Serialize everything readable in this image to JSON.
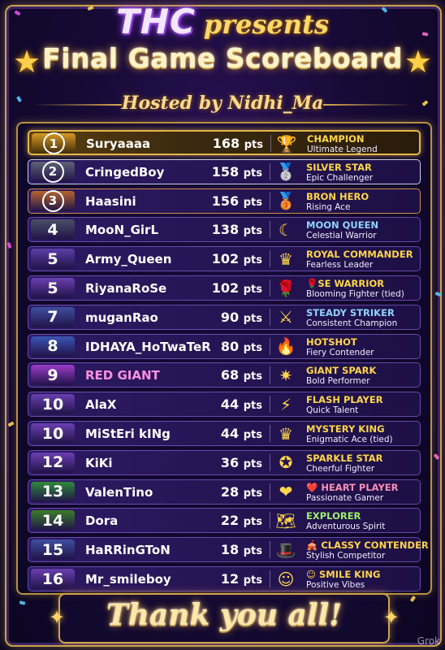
{
  "header": {
    "brand": "THC",
    "presents": "presents",
    "title": "Final Game Scoreboard",
    "hosted_by": "Hosted by Nidhi_Ma"
  },
  "colors": {
    "gold": "#ffd54a",
    "purple_row": "#2d1a63",
    "background": "#170a35"
  },
  "scoreboard": {
    "points_unit": "pts",
    "rows": [
      {
        "rank": "1",
        "name": "Suryaaaa",
        "points": "168",
        "icon": "trophy-icon",
        "glyph": "🏆",
        "award": "CHAMPION",
        "subtitle": "Ultimate Legend",
        "name_color": "#ffffff",
        "award_color": "#ffd54a",
        "rank_bg": "#d79a25"
      },
      {
        "rank": "2",
        "name": "CringedBoy",
        "points": "158",
        "icon": "silver-medal-icon",
        "glyph": "🥈",
        "award": "SILVER STAR",
        "subtitle": "Epic Challenger",
        "name_color": "#ffffff",
        "award_color": "#ffd54a",
        "rank_bg": "#5d6275"
      },
      {
        "rank": "3",
        "name": "Haasini",
        "points": "156",
        "icon": "bronze-medal-icon",
        "glyph": "🥉",
        "award": "BRON HERO",
        "subtitle": "Rising Ace",
        "name_color": "#ffffff",
        "award_color": "#ffd54a",
        "rank_bg": "#b5652b"
      },
      {
        "rank": "4",
        "name": "MooN_GirL",
        "points": "138",
        "icon": "crescent-moon-icon",
        "glyph": "☾",
        "award": "MOON QUEEN",
        "subtitle": "Celestial Warrior",
        "name_color": "#ffffff",
        "award_color": "#8fd2ff",
        "rank_bg": "#4a4f66"
      },
      {
        "rank": "5",
        "name": "Army_Queen",
        "points": "102",
        "icon": "crown-icon",
        "glyph": "♛",
        "award": "ROYAL COMMANDER",
        "subtitle": "Fearless Leader",
        "name_color": "#ffffff",
        "award_color": "#ffd54a",
        "rank_bg": "#5b3ea8"
      },
      {
        "rank": "5",
        "name": "RiyanaRoSe",
        "points": "102",
        "icon": "rose-icon",
        "glyph": "🌹",
        "award": "🌹SE WARRIOR",
        "subtitle": "Blooming Fighter (tied)",
        "name_color": "#ffffff",
        "award_color": "#ffd54a",
        "rank_bg": "#6a3fb0"
      },
      {
        "rank": "7",
        "name": "muganRao",
        "points": "90",
        "icon": "crossed-swords-icon",
        "glyph": "⚔",
        "award": "STEADY STRIKER",
        "subtitle": "Consistent Champion",
        "name_color": "#ffffff",
        "award_color": "#8fd2ff",
        "rank_bg": "#3e4fa0"
      },
      {
        "rank": "8",
        "name": "IDHAYA_HoTwaTeR",
        "points": "80",
        "icon": "flame-icon",
        "glyph": "🔥",
        "award": "HOTSHOT",
        "subtitle": "Fiery Contender",
        "name_color": "#ffffff",
        "award_color": "#ffd54a",
        "rank_bg": "#3a55b5"
      },
      {
        "rank": "9",
        "name": "RED GIANT",
        "points": "68",
        "icon": "burst-star-icon",
        "glyph": "✷",
        "award": "GIANT SPARK",
        "subtitle": "Bold Performer",
        "name_color": "#ff8fe0",
        "award_color": "#ffd54a",
        "rank_bg": "#9b3cc9"
      },
      {
        "rank": "10",
        "name": "AlaX",
        "points": "44",
        "icon": "lightning-icon",
        "glyph": "⚡",
        "award": "FLASH PLAYER",
        "subtitle": "Quick Talent",
        "name_color": "#ffffff",
        "award_color": "#ffd54a",
        "rank_bg": "#6a3fb0"
      },
      {
        "rank": "10",
        "name": "MiStEri kINg",
        "points": "44",
        "icon": "crown-icon",
        "glyph": "♛",
        "award": "MYSTERY KING",
        "subtitle": "Enigmatic Ace (tied)",
        "name_color": "#ffffff",
        "award_color": "#ffd54a",
        "rank_bg": "#6a3fb0"
      },
      {
        "rank": "12",
        "name": "KiKi",
        "points": "36",
        "icon": "star-badge-icon",
        "glyph": "✪",
        "award": "SPARKLE STAR",
        "subtitle": "Cheerful Fighter",
        "name_color": "#ffffff",
        "award_color": "#ffd54a",
        "rank_bg": "#6a3fb0"
      },
      {
        "rank": "13",
        "name": "ValenTino",
        "points": "28",
        "icon": "heart-icon",
        "glyph": "❤",
        "award": "❤️ HEART PLAYER",
        "subtitle": "Passionate Gamer",
        "name_color": "#ffffff",
        "award_color": "#ff8fb8",
        "rank_bg": "#2f8a3a"
      },
      {
        "rank": "14",
        "name": "Dora",
        "points": "22",
        "icon": "map-icon",
        "glyph": "🗺",
        "award": "EXPLORER",
        "subtitle": "Adventurous Spirit",
        "name_color": "#ffffff",
        "award_color": "#9ff06a",
        "rank_bg": "#3c7d2a"
      },
      {
        "rank": "15",
        "name": "HaRRinGToN",
        "points": "18",
        "icon": "top-hat-icon",
        "glyph": "🎩",
        "award": "🎪 CLASSY CONTENDER",
        "subtitle": "Stylish Competitor",
        "name_color": "#ffffff",
        "award_color": "#ffd54a",
        "rank_bg": "#3e4fa0"
      },
      {
        "rank": "16",
        "name": "Mr_smileboy",
        "points": "12",
        "icon": "smiley-icon",
        "glyph": "☺",
        "award": "☺ SMILE KING",
        "subtitle": "Positive Vibes",
        "name_color": "#ffffff",
        "award_color": "#ffd54a",
        "rank_bg": "#6a3fb0"
      }
    ]
  },
  "footer": {
    "thanks": "Thank you all!",
    "watermark": "Grok"
  }
}
